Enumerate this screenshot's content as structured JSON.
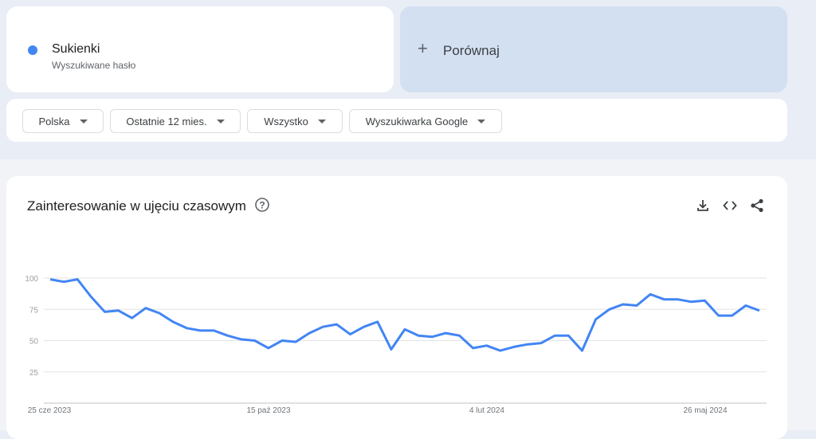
{
  "search_term": {
    "name": "Sukienki",
    "subtitle": "Wyszukiwane hasło",
    "color": "#4285f4"
  },
  "compare": {
    "label": "Porównaj",
    "icon": "plus-icon"
  },
  "filters": [
    {
      "label": "Polska"
    },
    {
      "label": "Ostatnie 12 mies."
    },
    {
      "label": "Wszystko"
    },
    {
      "label": "Wyszukiwarka Google"
    }
  ],
  "chart_section": {
    "title": "Zainteresowanie w ujęciu czasowym",
    "icons": [
      "help-icon",
      "download-icon",
      "embed-code-icon",
      "share-icon"
    ]
  },
  "chart_data": {
    "type": "line",
    "y_ticks": [
      "100",
      "75",
      "50",
      "25"
    ],
    "ylim": [
      0,
      100
    ],
    "x_tick_labels": [
      "25 cze 2023",
      "15 paź 2023",
      "4 lut 2024",
      "26 maj 2024"
    ],
    "series": [
      {
        "color": "#4285f4",
        "values": [
          99,
          97,
          99,
          85,
          73,
          74,
          68,
          76,
          72,
          65,
          60,
          58,
          58,
          54,
          51,
          50,
          44,
          50,
          49,
          56,
          61,
          63,
          55,
          61,
          65,
          43,
          59,
          54,
          53,
          56,
          54,
          44,
          46,
          42,
          45,
          47,
          48,
          54,
          54,
          42,
          67,
          75,
          79,
          78,
          87,
          83,
          83,
          81,
          82,
          70,
          70,
          78,
          74
        ]
      }
    ]
  }
}
